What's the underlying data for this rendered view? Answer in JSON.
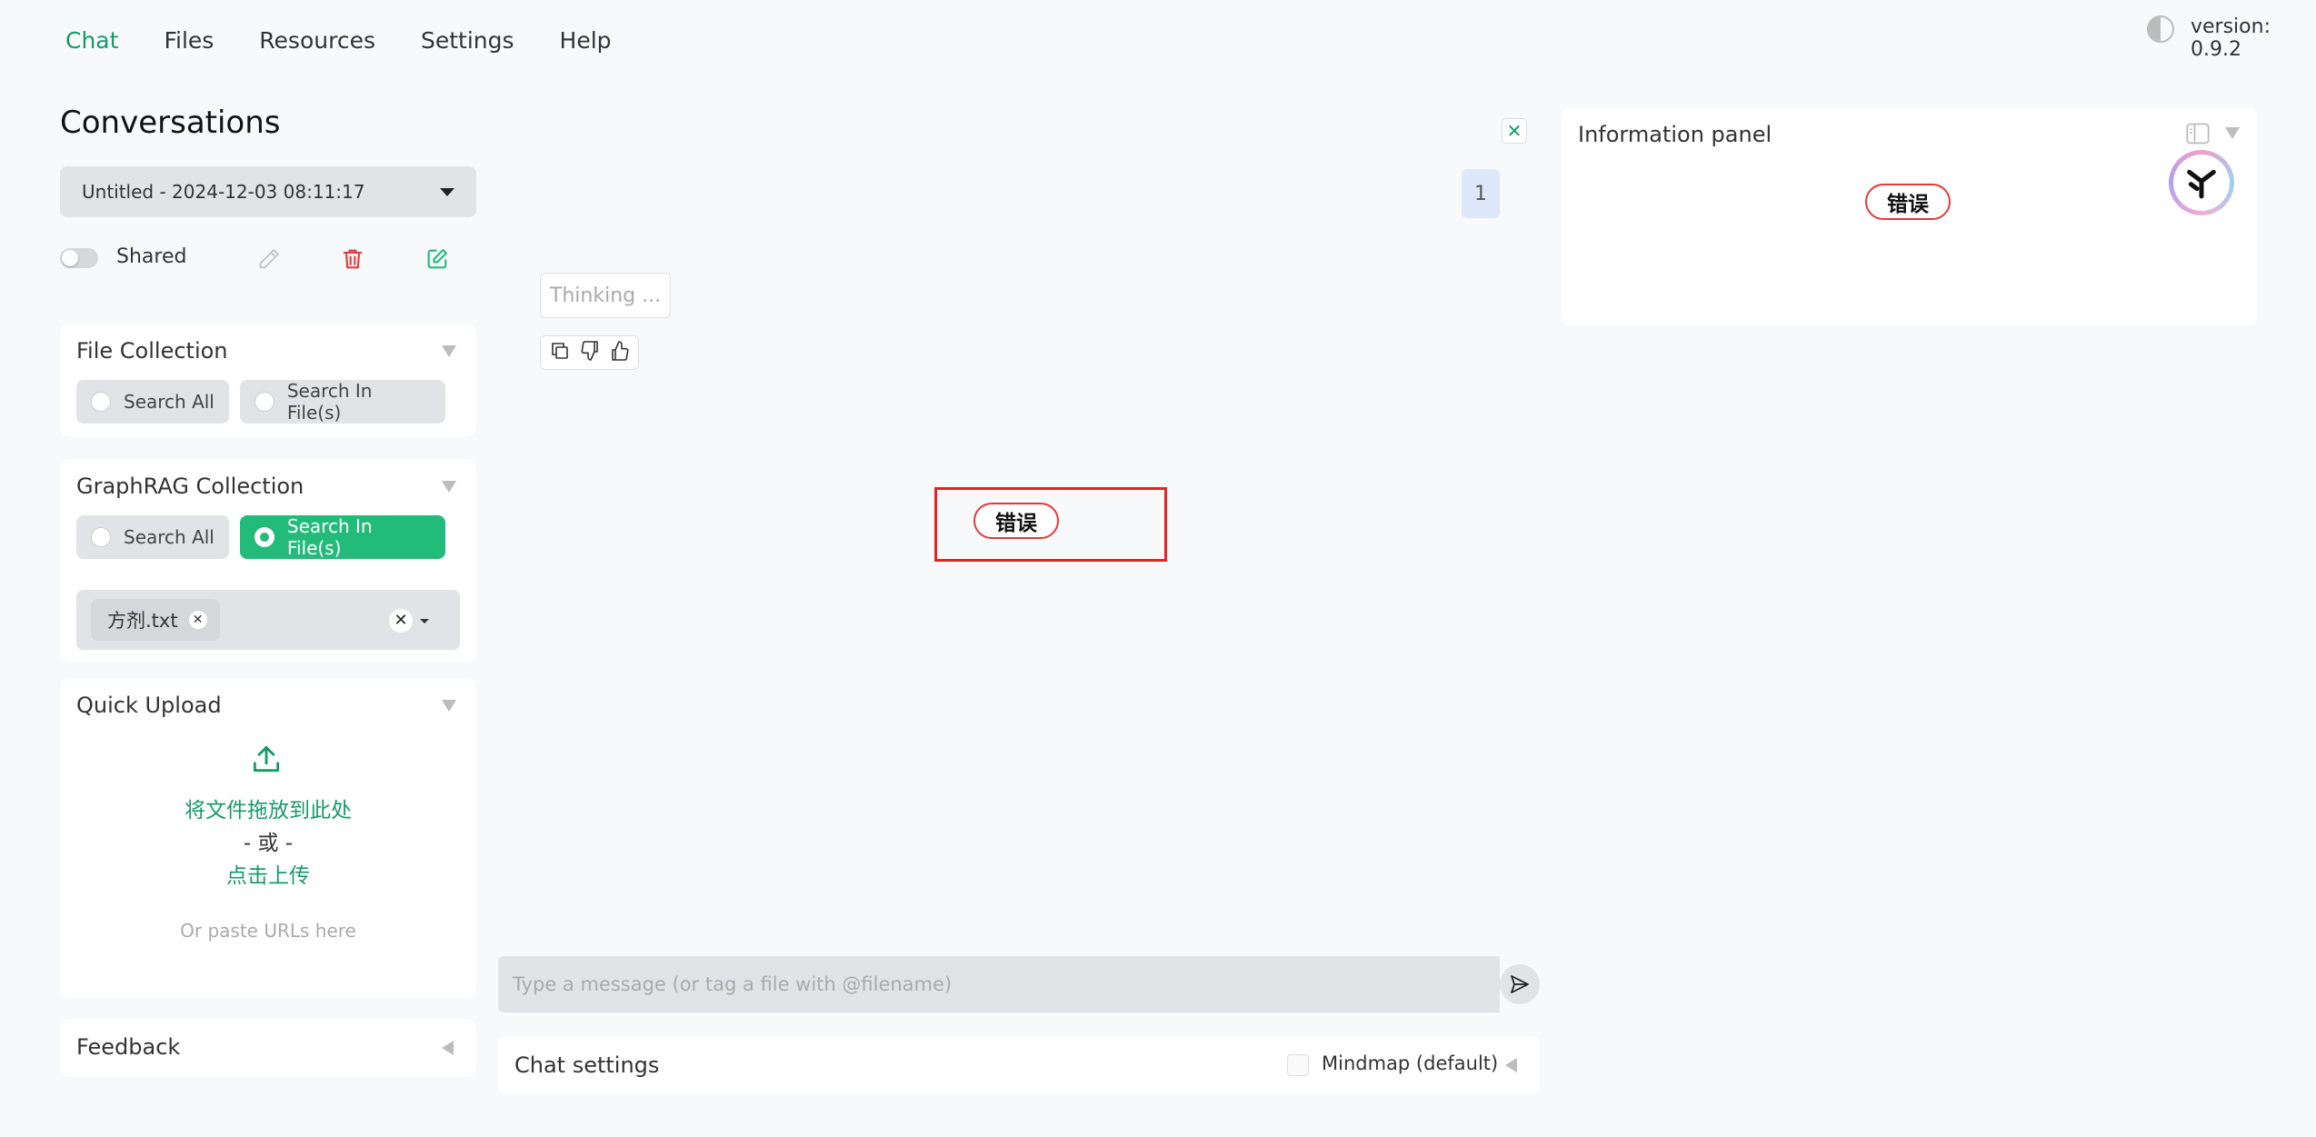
{
  "nav": {
    "items": [
      "Chat",
      "Files",
      "Resources",
      "Settings",
      "Help"
    ],
    "active": "Chat",
    "version": "version: 0.9.2"
  },
  "sidebar": {
    "title": "Conversations",
    "conversation_selected": "Untitled - 2024-12-03 08:11:17",
    "shared_label": "Shared",
    "file_collection": {
      "title": "File Collection",
      "options": [
        "Search All",
        "Search In File(s)"
      ],
      "selected": null
    },
    "graphrag_collection": {
      "title": "GraphRAG Collection",
      "options": [
        "Search All",
        "Search In File(s)"
      ],
      "selected": "Search In File(s)",
      "selected_file": "方剂.txt",
      "remove_symbol": "✕",
      "clear_symbol": "✕"
    },
    "quick_upload": {
      "title": "Quick Upload",
      "drop_text": "将文件拖放到此处",
      "or_text": "- 或 -",
      "click_text": "点击上传",
      "paste_hint": "Or paste URLs here"
    },
    "feedback_title": "Feedback"
  },
  "chat": {
    "close_symbol": "✕",
    "user_message": "1",
    "bot_message": "Thinking ...",
    "error_label": "错误",
    "input_placeholder": "Type a message (or tag a file with @filename)",
    "settings_title": "Chat settings",
    "mindmap_label": "Mindmap (default)"
  },
  "info_panel": {
    "title": "Information panel",
    "error_label": "错误"
  },
  "colors": {
    "accent": "#179a6a",
    "accent_fill": "#22bb7a",
    "danger": "#e33a3a"
  }
}
